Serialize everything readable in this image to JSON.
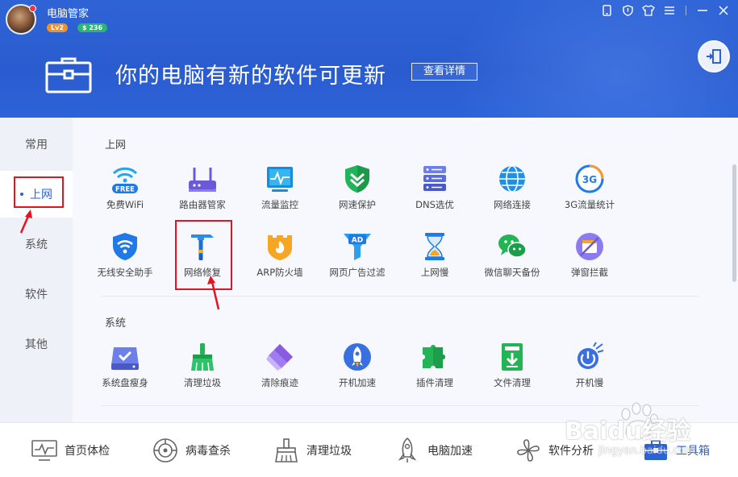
{
  "header": {
    "app_title": "电脑管家",
    "level_badge": "Lv2",
    "coins_badge": "$ 236",
    "headline": "你的电脑有新的软件可更新",
    "detail_button": "查看详情",
    "window_controls": [
      "phone-icon",
      "shield-icon",
      "shirt-icon",
      "menu-icon",
      "minimize-icon",
      "close-icon"
    ]
  },
  "sidebar": {
    "items": [
      {
        "label": "常用",
        "active": false
      },
      {
        "label": "上网",
        "active": true
      },
      {
        "label": "系统",
        "active": false
      },
      {
        "label": "软件",
        "active": false
      },
      {
        "label": "其他",
        "active": false
      }
    ]
  },
  "sections": [
    {
      "title": "上网",
      "tools": [
        {
          "label": "免费WiFi",
          "icon": "free-wifi-icon"
        },
        {
          "label": "路由器管家",
          "icon": "router-icon"
        },
        {
          "label": "流量监控",
          "icon": "traffic-monitor-icon"
        },
        {
          "label": "网速保护",
          "icon": "speed-shield-icon"
        },
        {
          "label": "DNS选优",
          "icon": "dns-server-icon"
        },
        {
          "label": "网络连接",
          "icon": "globe-icon"
        },
        {
          "label": "3G流量统计",
          "icon": "3g-icon"
        },
        {
          "label": "无线安全助手",
          "icon": "wifi-shield-icon"
        },
        {
          "label": "网络修复",
          "icon": "hammer-icon"
        },
        {
          "label": "ARP防火墙",
          "icon": "firewall-icon"
        },
        {
          "label": "网页广告过滤",
          "icon": "ad-filter-icon"
        },
        {
          "label": "上网慢",
          "icon": "hourglass-icon"
        },
        {
          "label": "微信聊天备份",
          "icon": "wechat-icon"
        },
        {
          "label": "弹窗拦截",
          "icon": "popup-block-icon"
        }
      ]
    },
    {
      "title": "系统",
      "tools": [
        {
          "label": "系统盘瘦身",
          "icon": "disk-slim-icon"
        },
        {
          "label": "清理垃圾",
          "icon": "broom-icon"
        },
        {
          "label": "清除痕迹",
          "icon": "eraser-icon"
        },
        {
          "label": "开机加速",
          "icon": "rocket-icon"
        },
        {
          "label": "插件清理",
          "icon": "puzzle-icon"
        },
        {
          "label": "文件清理",
          "icon": "file-clean-icon"
        },
        {
          "label": "开机慢",
          "icon": "slow-boot-icon"
        }
      ]
    }
  ],
  "bottom_nav": [
    {
      "label": "首页体检",
      "icon": "monitor-pulse-icon",
      "active": false
    },
    {
      "label": "病毒查杀",
      "icon": "virus-scan-icon",
      "active": false
    },
    {
      "label": "清理垃圾",
      "icon": "broom-outline-icon",
      "active": false
    },
    {
      "label": "电脑加速",
      "icon": "rocket-outline-icon",
      "active": false
    },
    {
      "label": "软件分析",
      "icon": "clover-icon",
      "active": false
    },
    {
      "label": "工具箱",
      "icon": "toolbox-icon",
      "active": true
    }
  ],
  "watermark": {
    "text": "Baidu经验",
    "url_text": "jingyan.baidu.com"
  },
  "colors": {
    "header_blue": "#2e63d6",
    "accent": "#2b62d6",
    "annotation_red": "#e8121f"
  }
}
